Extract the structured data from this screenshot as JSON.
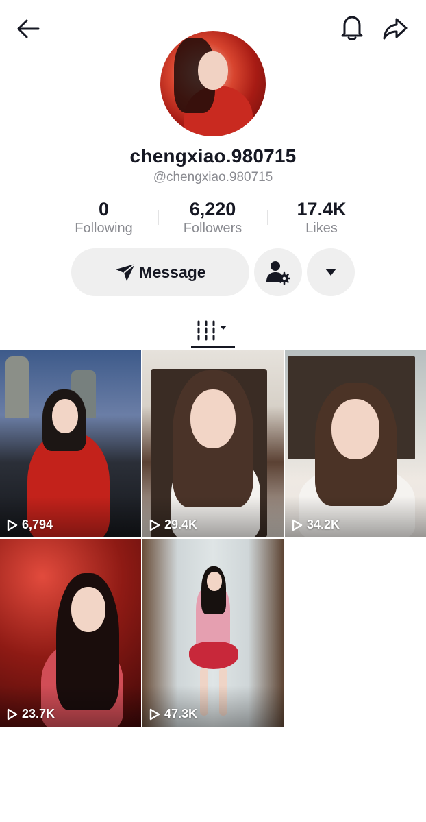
{
  "profile": {
    "display_name": "chengxiao.980715",
    "handle": "@chengxiao.980715"
  },
  "stats": [
    {
      "value": "0",
      "label": "Following"
    },
    {
      "value": "6,220",
      "label": "Followers"
    },
    {
      "value": "17.4K",
      "label": "Likes"
    }
  ],
  "actions": {
    "message_label": "Message"
  },
  "videos": [
    {
      "views": "6,794"
    },
    {
      "views": "29.4K"
    },
    {
      "views": "34.2K"
    },
    {
      "views": "23.7K"
    },
    {
      "views": "47.3K"
    }
  ],
  "icons": {
    "back": "back-arrow-icon",
    "bell": "bell-icon",
    "share": "share-icon",
    "message": "send-icon",
    "follow_settings": "user-gear-icon",
    "dropdown": "caret-down-icon",
    "tab": "grid-videos-icon",
    "play": "play-icon"
  },
  "colors": {
    "text_primary": "#161823",
    "text_secondary": "#8a8b91",
    "button_bg": "#efefef"
  }
}
